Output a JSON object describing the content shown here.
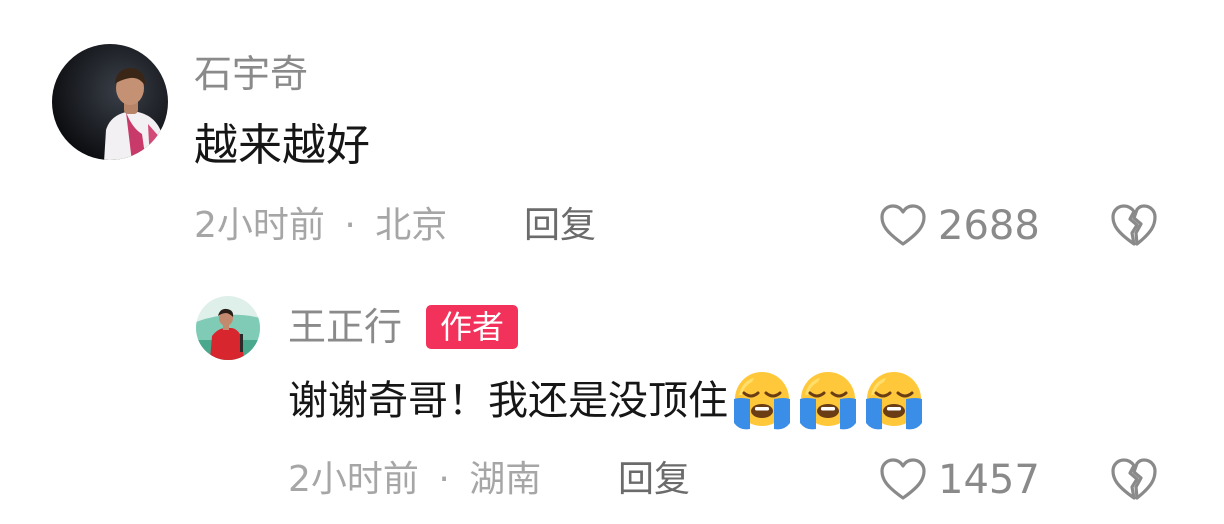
{
  "comments": [
    {
      "username": "石宇奇",
      "text": "越来越好",
      "time": "2小时前",
      "separator": "·",
      "location": "北京",
      "reply_label": "回复",
      "like_count": "2688",
      "avatar_icon": "user-avatar-photo",
      "like_icon": "heart-outline-icon",
      "dislike_icon": "broken-heart-icon"
    }
  ],
  "replies": [
    {
      "username": "王正行",
      "badge": "作者",
      "badge_color": "#f2325a",
      "text": "谢谢奇哥！我还是没顶住",
      "emojis": [
        "loudly-crying-face",
        "loudly-crying-face",
        "loudly-crying-face"
      ],
      "time": "2小时前",
      "separator": "·",
      "location": "湖南",
      "reply_label": "回复",
      "like_count": "1457",
      "avatar_icon": "user-avatar-photo",
      "like_icon": "heart-outline-icon",
      "dislike_icon": "broken-heart-icon"
    }
  ]
}
